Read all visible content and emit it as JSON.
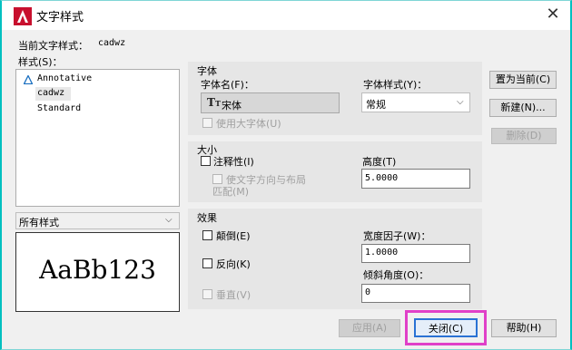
{
  "window": {
    "title": "文字样式",
    "close_glyph": "✕",
    "accent": "#c8102e",
    "frame_color": "#00c0c0"
  },
  "current_style": {
    "label": "当前文字样式：",
    "value": "cadwz"
  },
  "styles_label": "样式(S)：",
  "styles_list": [
    "Annotative",
    "cadwz",
    "Standard"
  ],
  "filter_select": {
    "value": "所有样式"
  },
  "preview_text": "AaBb123",
  "font_group": {
    "title": "字体",
    "font_name_label": "字体名(F)：",
    "font_name_value": "宋体",
    "font_icon_glyph": "T",
    "font_style_label": "字体样式(Y)：",
    "font_style_value": "常规",
    "big_font_label": "使用大字体(U)"
  },
  "size_group": {
    "title": "大小",
    "annotative_label": "注释性(I)",
    "match_layout_label_line1": "使文字方向与布局",
    "match_layout_label_line2": "匹配(M)",
    "height_label": "高度(T)",
    "height_value": "5.0000"
  },
  "effects_group": {
    "title": "效果",
    "upside_down_label": "颠倒(E)",
    "backwards_label": "反向(K)",
    "vertical_label": "垂直(V)",
    "width_factor_label": "宽度因子(W)：",
    "width_factor_value": "1.0000",
    "oblique_label": "倾斜角度(O)：",
    "oblique_value": "0"
  },
  "buttons": {
    "set_current": "置为当前(C)",
    "new": "新建(N)...",
    "delete": "删除(D)",
    "apply": "应用(A)",
    "close": "关闭(C)",
    "help": "帮助(H)"
  },
  "highlight_color": "#e040c8"
}
